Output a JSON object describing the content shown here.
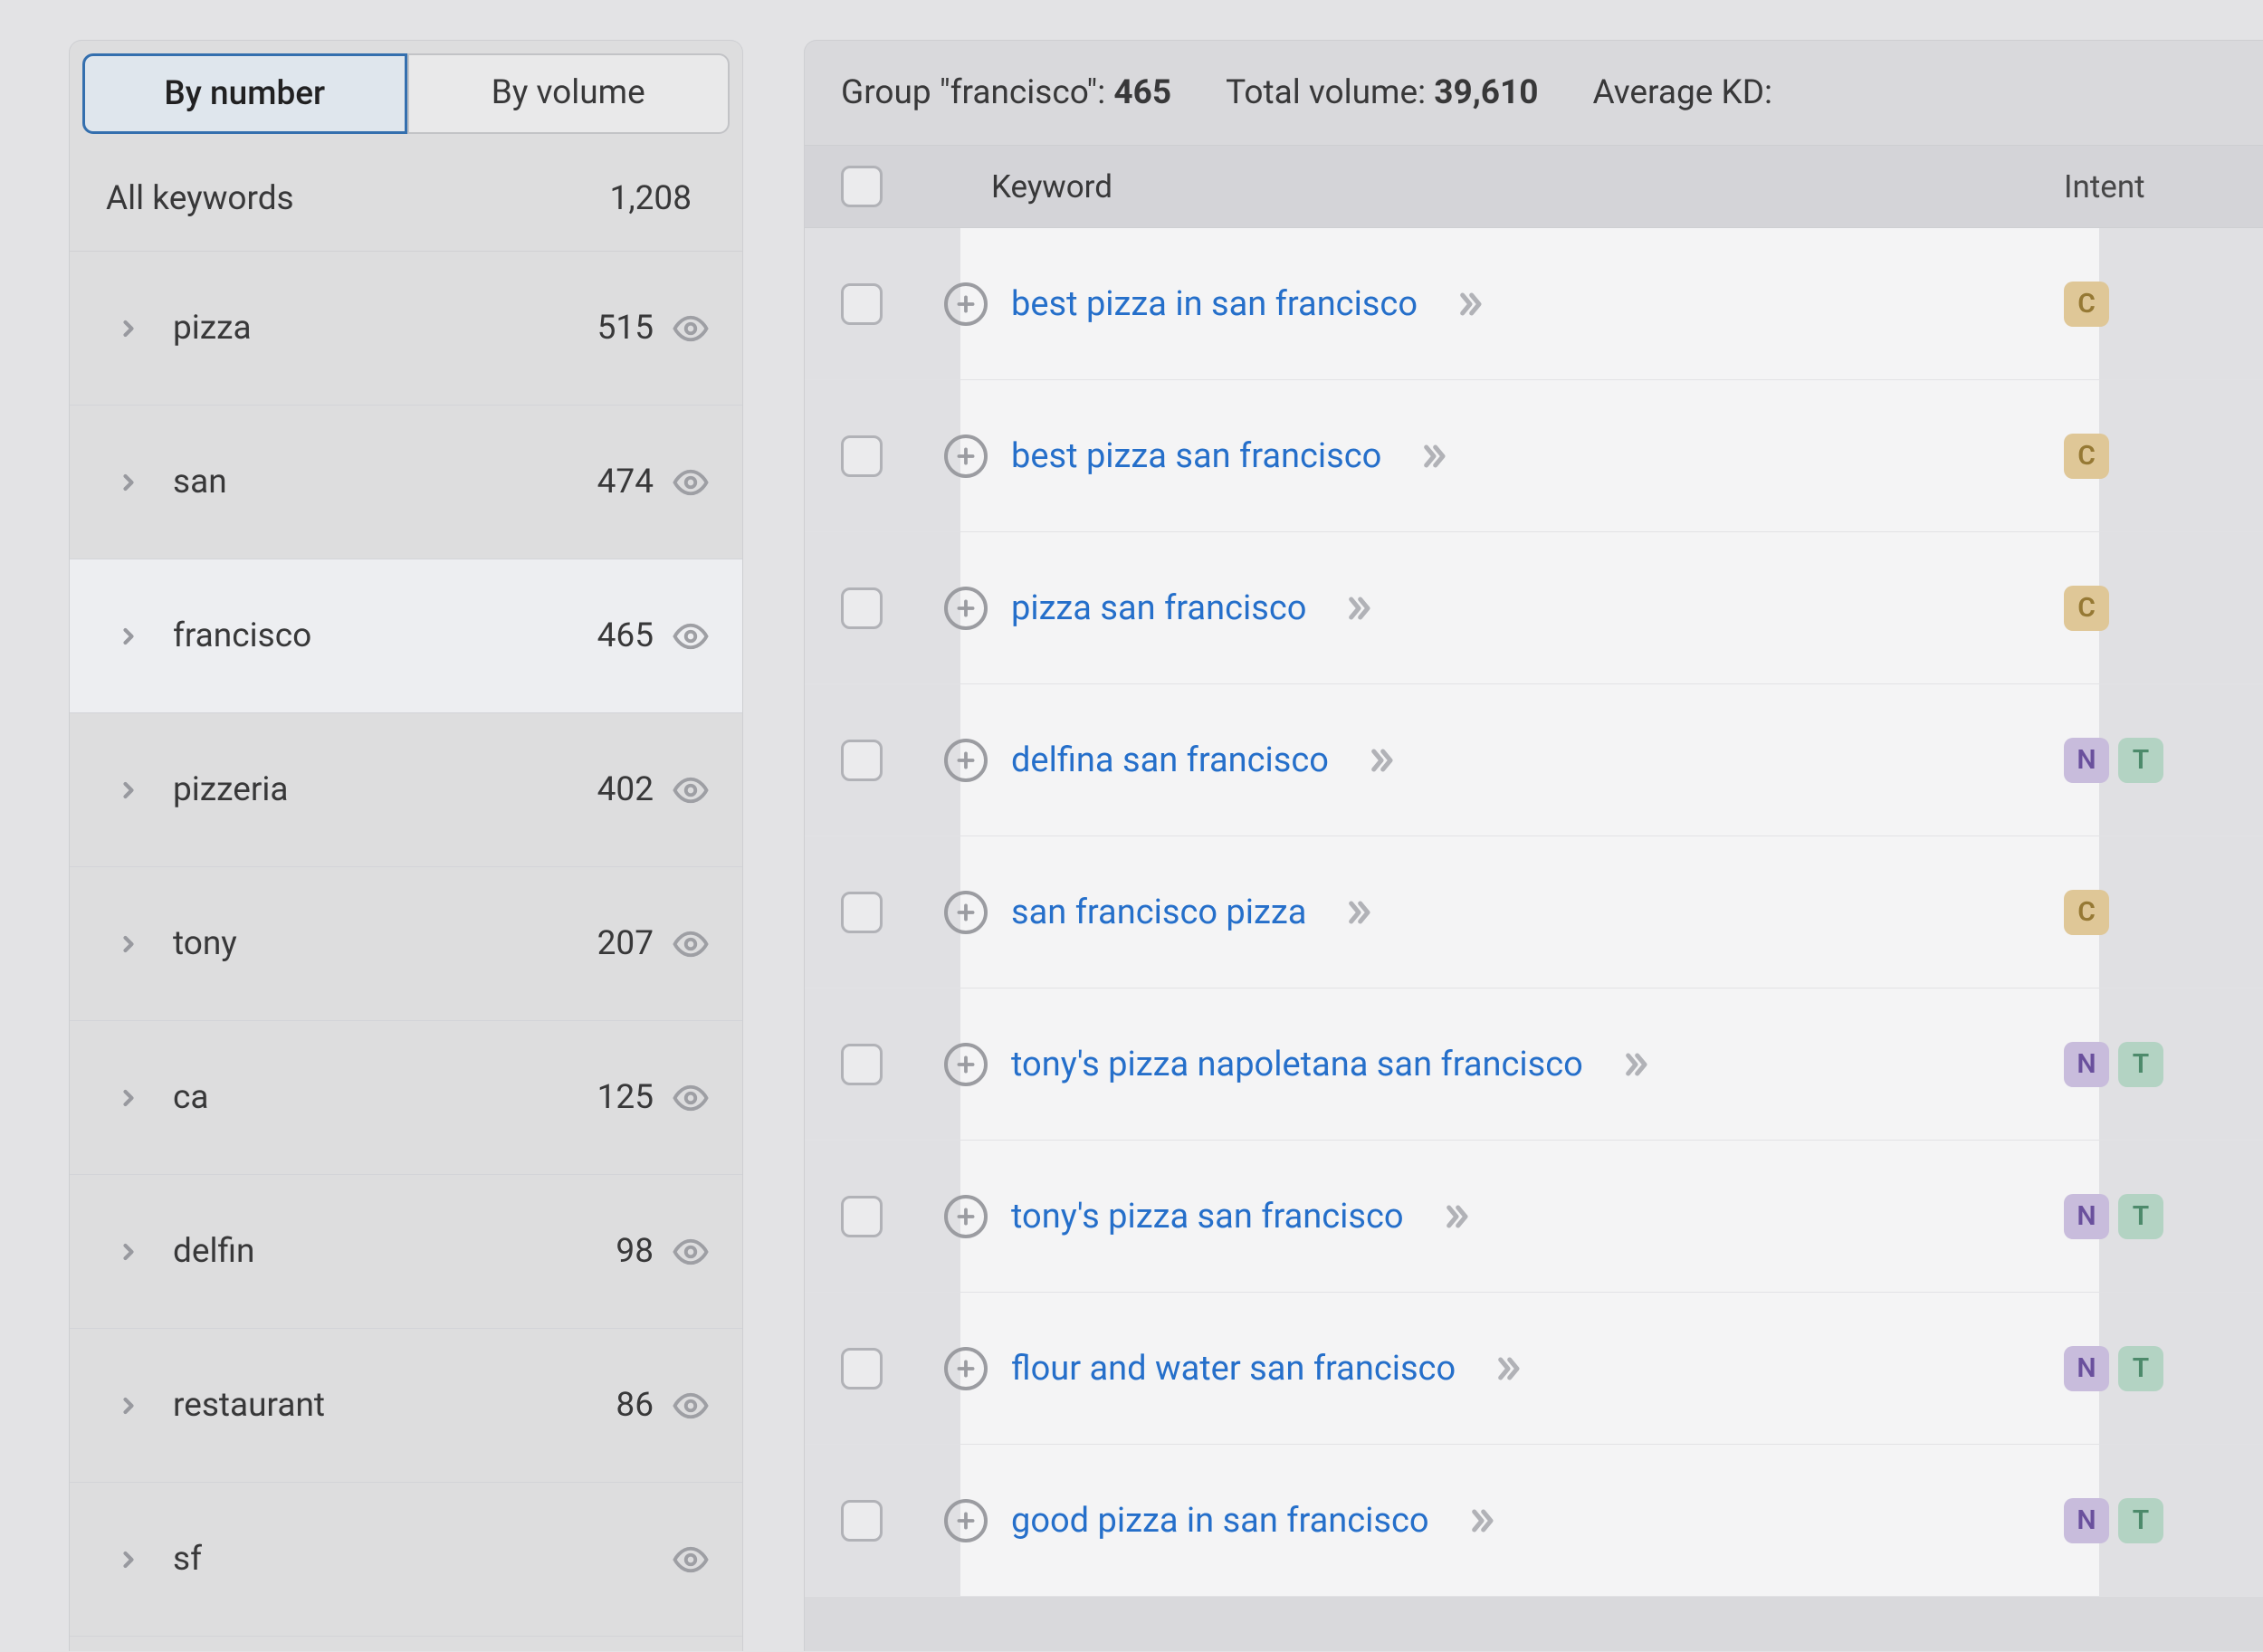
{
  "sidebar": {
    "toggles": {
      "by_number": "By number",
      "by_volume": "By volume",
      "active": "by_number"
    },
    "all_label": "All keywords",
    "all_count": "1,208",
    "groups": [
      {
        "label": "pizza",
        "count": "515",
        "active": false
      },
      {
        "label": "san",
        "count": "474",
        "active": false
      },
      {
        "label": "francisco",
        "count": "465",
        "active": true
      },
      {
        "label": "pizzeria",
        "count": "402",
        "active": false
      },
      {
        "label": "tony",
        "count": "207",
        "active": false
      },
      {
        "label": "ca",
        "count": "125",
        "active": false
      },
      {
        "label": "delfin",
        "count": "98",
        "active": false
      },
      {
        "label": "restaurant",
        "count": "86",
        "active": false
      },
      {
        "label": "sf",
        "count": "",
        "active": false
      }
    ]
  },
  "stats": {
    "group_prefix": "Group \"",
    "group_name": "francisco",
    "group_suffix": "\": ",
    "group_count": "465",
    "volume_label": "Total volume: ",
    "volume_value": "39,610",
    "kd_label": "Average KD:"
  },
  "table": {
    "header_keyword": "Keyword",
    "header_intent": "Intent",
    "rows": [
      {
        "keyword": "best pizza in san francisco",
        "intents": [
          "C"
        ]
      },
      {
        "keyword": "best pizza san francisco",
        "intents": [
          "C"
        ]
      },
      {
        "keyword": "pizza san francisco",
        "intents": [
          "C"
        ]
      },
      {
        "keyword": "delfina san francisco",
        "intents": [
          "N",
          "T"
        ]
      },
      {
        "keyword": "san francisco pizza",
        "intents": [
          "C"
        ]
      },
      {
        "keyword": "tony's pizza napoletana san francisco",
        "intents": [
          "N",
          "T"
        ]
      },
      {
        "keyword": "tony's pizza san francisco",
        "intents": [
          "N",
          "T"
        ]
      },
      {
        "keyword": "flour and water san francisco",
        "intents": [
          "N",
          "T"
        ]
      },
      {
        "keyword": "good pizza in san francisco",
        "intents": [
          "N",
          "T"
        ]
      }
    ]
  }
}
